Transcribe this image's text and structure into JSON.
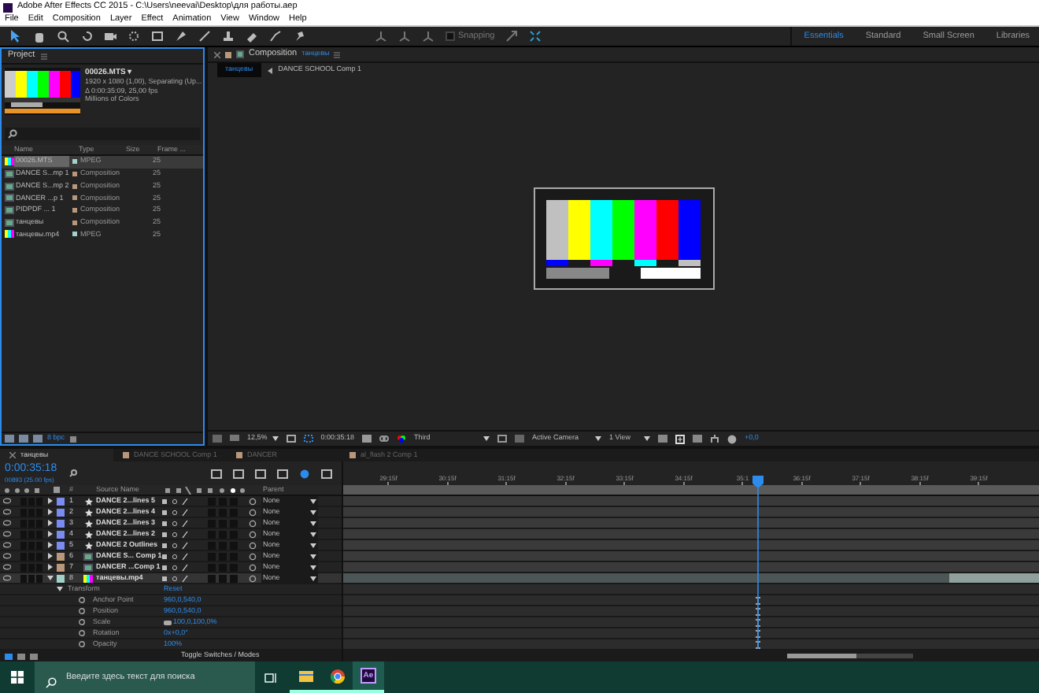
{
  "window": {
    "title": "Adobe After Effects CC 2015 - C:\\Users\\neevai\\Desktop\\для работы.aep"
  },
  "menu": [
    "File",
    "Edit",
    "Composition",
    "Layer",
    "Effect",
    "Animation",
    "View",
    "Window",
    "Help"
  ],
  "toolbar": {
    "snapping": "Snapping",
    "snapping_checked": false,
    "workspaces": [
      {
        "label": "Essentials",
        "selected": true
      },
      {
        "label": "Standard",
        "selected": false
      },
      {
        "label": "Small Screen",
        "selected": false
      },
      {
        "label": "Libraries",
        "selected": false
      }
    ]
  },
  "project": {
    "title": "Project",
    "file": "00026.MTS ▾",
    "info": [
      "1920 x 1080 (1,00), Separating (Up...",
      "Δ 0:00:35:09, 25,00 fps",
      "Millions of Colors"
    ],
    "columns": [
      "Name",
      "Type",
      "Size",
      "Frame ..."
    ],
    "items": [
      {
        "name": "00026.MTS",
        "type": "MPEG",
        "frame": "25",
        "kind": "footage",
        "selected": true
      },
      {
        "name": "DANCE S...mp 1",
        "type": "Composition",
        "frame": "25",
        "kind": "comp",
        "selected": false
      },
      {
        "name": "DANCE S...mp 2",
        "type": "Composition",
        "frame": "25",
        "kind": "comp",
        "selected": false
      },
      {
        "name": "DANCER ...p 1",
        "type": "Composition",
        "frame": "25",
        "kind": "comp",
        "selected": false
      },
      {
        "name": "PIDPDF ... 1",
        "type": "Composition",
        "frame": "25",
        "kind": "comp",
        "selected": false
      },
      {
        "name": "танцевы",
        "type": "Composition",
        "frame": "25",
        "kind": "comp",
        "selected": false
      },
      {
        "name": "танцевы.mp4",
        "type": "MPEG",
        "frame": "25",
        "kind": "footage",
        "selected": false
      }
    ],
    "bpc": "8 bpc"
  },
  "composition": {
    "title": "Composition",
    "comp_name": "танцевы",
    "breadcrumbs": [
      {
        "label": "танцевы",
        "selected": true
      },
      {
        "label": "DANCE SCHOOL Comp 1",
        "selected": false
      }
    ],
    "controls": {
      "zoom": "12,5%",
      "time": "0:00:35:18",
      "resolution": "Third",
      "camera": "Active Camera",
      "views": "1 View",
      "exposure": "+0,0"
    }
  },
  "timeline": {
    "tabs": [
      {
        "label": "танцевы",
        "selected": true
      },
      {
        "label": "DANCE SCHOOL Comp 1",
        "selected": false
      },
      {
        "label": "DANCER",
        "selected": false
      },
      {
        "label": "al_flash 2 Comp 1",
        "selected": false
      }
    ],
    "time": "0:00:35:18",
    "frames": "00893 (25.00 fps)",
    "columns": {
      "number": "#",
      "source": "Source Name",
      "parent": "Parent"
    },
    "ruler": [
      "29:15f",
      "30:15f",
      "31:15f",
      "32:15f",
      "33:15f",
      "34:15f",
      "35:1",
      "36:15f",
      "37:15f",
      "38:15f",
      "39:15f"
    ],
    "layers": [
      {
        "number": "1",
        "name": "DANCE 2...lines 5",
        "color": "#7b8cf0",
        "kind": "shape",
        "expanded": false,
        "selected": false,
        "parent": "None"
      },
      {
        "number": "2",
        "name": "DANCE 2...lines 4",
        "color": "#7b8cf0",
        "kind": "shape",
        "expanded": false,
        "selected": false,
        "parent": "None"
      },
      {
        "number": "3",
        "name": "DANCE 2...lines 3",
        "color": "#7b8cf0",
        "kind": "shape",
        "expanded": false,
        "selected": false,
        "parent": "None"
      },
      {
        "number": "4",
        "name": "DANCE 2...lines 2",
        "color": "#7b8cf0",
        "kind": "shape",
        "expanded": false,
        "selected": false,
        "parent": "None"
      },
      {
        "number": "5",
        "name": "DANCE 2 Outlines",
        "color": "#7b8cf0",
        "kind": "shape",
        "expanded": false,
        "selected": false,
        "parent": "None"
      },
      {
        "number": "6",
        "name": "DANCE S... Comp 1",
        "color": "#b8977a",
        "kind": "comp",
        "expanded": false,
        "selected": false,
        "parent": "None"
      },
      {
        "number": "7",
        "name": "DANCER ...Comp 1",
        "color": "#b8977a",
        "kind": "comp",
        "expanded": false,
        "selected": false,
        "parent": "None"
      },
      {
        "number": "8",
        "name": "танцевы.mp4",
        "color": "#a3d0c8",
        "kind": "footage",
        "expanded": true,
        "selected": true,
        "parent": "None"
      }
    ],
    "properties": [
      {
        "name": "Transform",
        "value": "Reset",
        "kind": "group"
      },
      {
        "name": "Anchor Point",
        "value": "960,0,540,0",
        "kind": "property"
      },
      {
        "name": "Position",
        "value": "960,0,540,0",
        "kind": "property"
      },
      {
        "name": "Scale",
        "value": "100,0,100,0%",
        "kind": "linked"
      },
      {
        "name": "Rotation",
        "value": "0x+0,0°",
        "kind": "property"
      },
      {
        "name": "Opacity",
        "value": "100%",
        "kind": "property"
      }
    ],
    "toggle": "Toggle Switches / Modes",
    "zoom_slider": {
      "level": 0.55
    }
  },
  "taskbar": {
    "placeholder": "Введите здесь текст для поиска",
    "app_label": "Ae"
  }
}
